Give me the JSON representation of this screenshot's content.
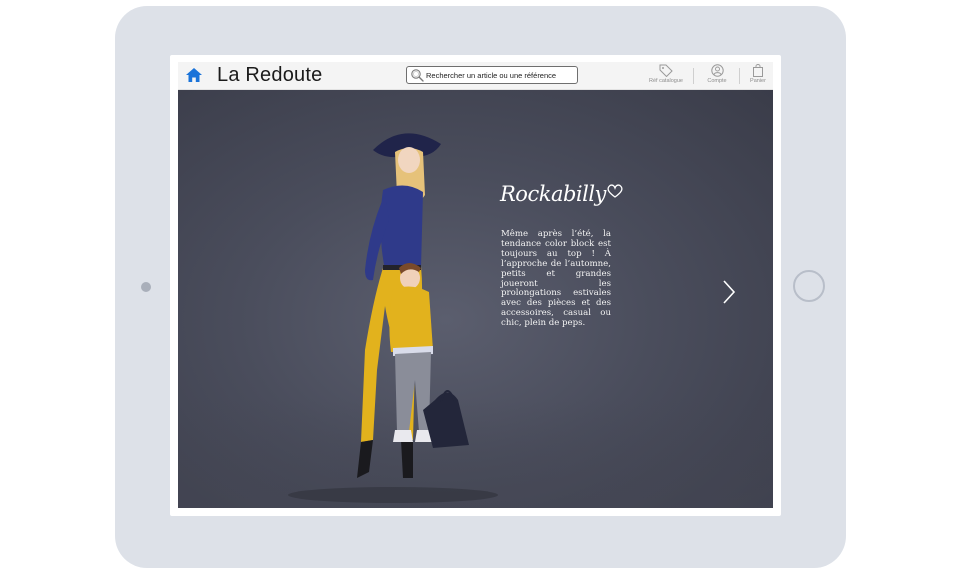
{
  "app": {
    "brand": "La Redoute"
  },
  "search": {
    "placeholder": "Rechercher un article ou une référence"
  },
  "toolbar": {
    "catalog_label": "Réf catalogue",
    "account_label": "Compte",
    "cart_label": "Panier"
  },
  "hero": {
    "title": "Rockabilly",
    "description": "Même après l’été, la tendance color block est toujours au top ! À l’approche de l’automne, petits et grandes joueront les prolongations estivales avec des pièces et des accessoires, casual ou chic, plein de peps."
  },
  "icons": {
    "home": "home-icon",
    "search": "search-icon",
    "catalog": "tag-icon",
    "account": "user-icon",
    "cart": "bag-icon",
    "next": "chevron-right-icon"
  },
  "colors": {
    "accent": "#1a73d9",
    "tablet_frame": "#dde1e8",
    "hero_background": "#4a4d5c",
    "mustard": "#e2b21d",
    "navy": "#2f3a8a"
  }
}
